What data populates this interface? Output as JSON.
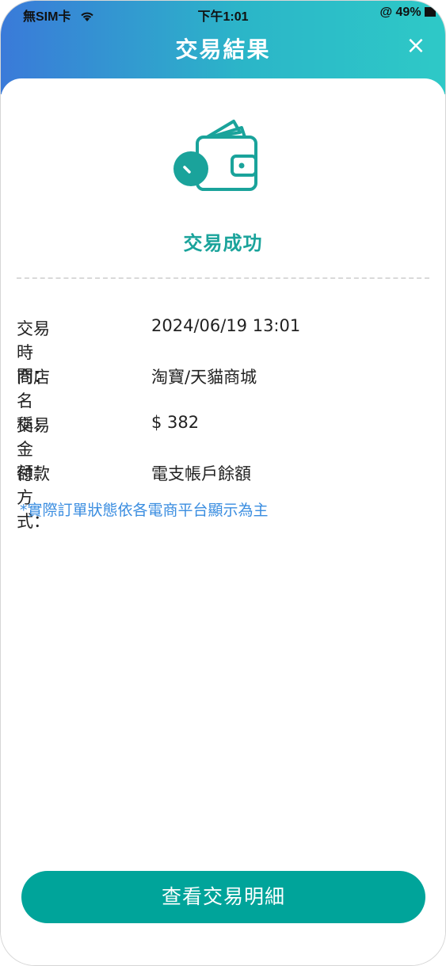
{
  "status_bar": {
    "carrier": "無SIM卡",
    "time": "下午1:01",
    "battery": "49%"
  },
  "header": {
    "title": "交易結果",
    "close_label": "×"
  },
  "result": {
    "status": "交易成功",
    "icon": "wallet-check-icon"
  },
  "details": [
    {
      "label": "交易時間：",
      "value": "2024/06/19 13:01"
    },
    {
      "label": "商店名稱：",
      "value": "淘寶/天貓商城"
    },
    {
      "label": "交易金額：",
      "value": "$ 382"
    },
    {
      "label": "付款方式：",
      "value": "電支帳戶餘額"
    }
  ],
  "note": "*實際訂單狀態依各電商平台顯示為主",
  "button": {
    "label": "查看交易明細"
  },
  "colors": {
    "accent": "#1aa39b",
    "button": "#00a49a",
    "note": "#3a8de0",
    "header_start": "#3a7ad9",
    "header_end": "#2ec9c7"
  }
}
